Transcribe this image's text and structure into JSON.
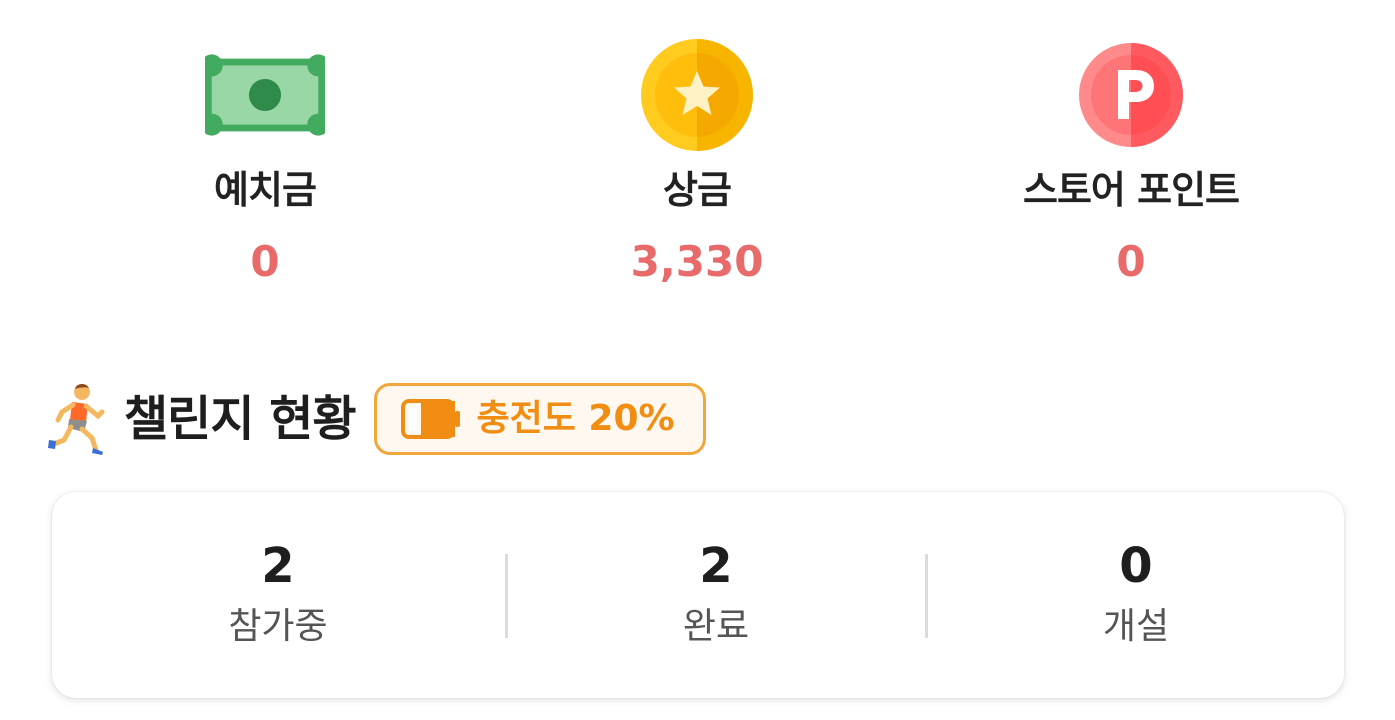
{
  "balances": {
    "deposit": {
      "label": "예치금",
      "value": "0",
      "icon": "banknote-icon"
    },
    "prize": {
      "label": "상금",
      "value": "3,330",
      "icon": "star-coin-icon"
    },
    "store_points": {
      "label": "스토어 포인트",
      "value": "0",
      "icon": "p-point-icon"
    }
  },
  "challenge": {
    "title": "챌린지 현황",
    "icon": "runner-icon",
    "charge_badge": {
      "text": "충전도 20%",
      "icon": "battery-icon",
      "level": 0.2
    }
  },
  "stats": [
    {
      "value": "2",
      "label": "참가중"
    },
    {
      "value": "2",
      "label": "완료"
    },
    {
      "value": "0",
      "label": "개설"
    }
  ],
  "colors": {
    "value_red": "#e96a6a",
    "badge_orange": "#f08d12",
    "badge_border": "#f2a73b",
    "badge_bg": "#fff8f0",
    "money_green": "#3aa85f",
    "coin_yellow": "#ffc20e",
    "point_red": "#ff5a5f"
  }
}
